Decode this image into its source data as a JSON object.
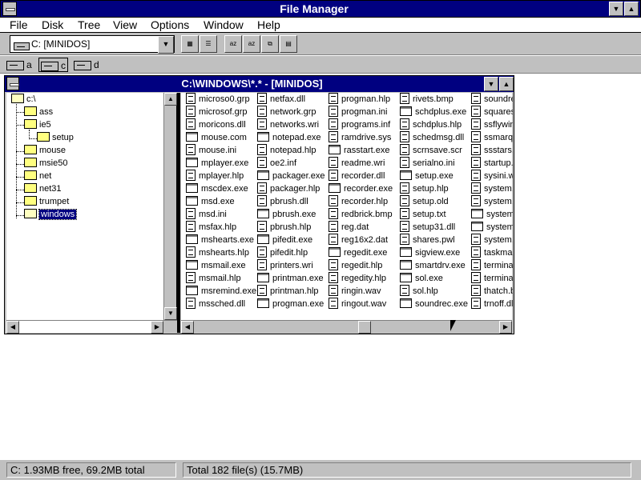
{
  "window": {
    "title": "File Manager"
  },
  "menu": [
    "File",
    "Disk",
    "Tree",
    "View",
    "Options",
    "Window",
    "Help"
  ],
  "toolbar": {
    "drive_selector": "C: [MINIDOS]"
  },
  "drives": [
    "a",
    "c",
    "d"
  ],
  "child": {
    "title": "C:\\WINDOWS\\*.* - [MINIDOS]"
  },
  "tree": {
    "root": "c:\\",
    "folders": [
      "ass",
      "ie5",
      "setup",
      "mouse",
      "msie50",
      "net",
      "net31",
      "trumpet",
      "windows"
    ]
  },
  "files": {
    "col1": [
      "microso0.grp",
      "microsof.grp",
      "moricons.dll",
      "mouse.com",
      "mouse.ini",
      "mplayer.exe",
      "mplayer.hlp",
      "mscdex.exe",
      "msd.exe",
      "msd.ini",
      "msfax.hlp",
      "mshearts.exe",
      "mshearts.hlp",
      "msmail.exe",
      "msmail.hlp",
      "msremind.exe",
      "mssched.dll"
    ],
    "col2": [
      "netfax.dll",
      "network.grp",
      "networks.wri",
      "notepad.exe",
      "notepad.hlp",
      "oe2.inf",
      "packager.exe",
      "packager.hlp",
      "pbrush.dll",
      "pbrush.exe",
      "pbrush.hlp",
      "pifedit.exe",
      "pifedit.hlp",
      "printers.wri",
      "printman.exe",
      "printman.hlp",
      "progman.exe"
    ],
    "col3": [
      "progman.hlp",
      "progman.ini",
      "programs.inf",
      "ramdrive.sys",
      "rasstart.exe",
      "readme.wri",
      "recorder.dll",
      "recorder.exe",
      "recorder.hlp",
      "redbrick.bmp",
      "reg.dat",
      "reg16x2.dat",
      "regedit.exe",
      "regedit.hlp",
      "regedity.hlp",
      "ringin.wav",
      "ringout.wav"
    ],
    "col4": [
      "rivets.bmp",
      "schdplus.exe",
      "schdplus.hlp",
      "schedmsg.dll",
      "scrnsave.scr",
      "serialno.ini",
      "setup.exe",
      "setup.hlp",
      "setup.old",
      "setup.txt",
      "setup31.dll",
      "shares.pwl",
      "sigview.exe",
      "smartdrv.exe",
      "sol.exe",
      "sol.hlp",
      "soundrec.exe"
    ],
    "col5": [
      "soundre",
      "squares",
      "ssflywin",
      "ssmarqu",
      "ssstars.s",
      "startup.g",
      "sysini.wi",
      "system.c",
      "system.c",
      "system.e",
      "system.e",
      "system.i",
      "taskmar",
      "terminal",
      "terminal",
      "thatch.b",
      "trnoff.dll"
    ]
  },
  "status": {
    "free": "C: 1.93MB free,  69.2MB total",
    "total": "Total 182 file(s) (15.7MB)"
  }
}
